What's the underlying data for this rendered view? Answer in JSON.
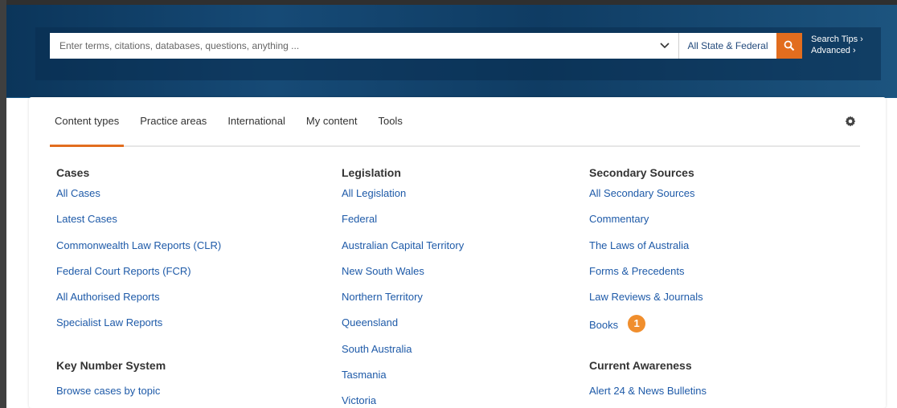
{
  "search": {
    "placeholder": "Enter terms, citations, databases, questions, anything ...",
    "jurisdiction": "All State & Federal",
    "tips_label": "Search Tips ›",
    "advanced_label": "Advanced ›"
  },
  "tabs": [
    {
      "label": "Content types",
      "active": true
    },
    {
      "label": "Practice areas"
    },
    {
      "label": "International"
    },
    {
      "label": "My content"
    },
    {
      "label": "Tools"
    }
  ],
  "columns": {
    "cases": {
      "heading": "Cases",
      "links": [
        "All Cases",
        "Latest Cases",
        "Commonwealth Law Reports (CLR)",
        "Federal Court Reports (FCR)",
        "All Authorised Reports",
        "Specialist Law Reports"
      ]
    },
    "key_number": {
      "heading": "Key Number System",
      "links": [
        "Browse cases by topic"
      ]
    },
    "legislation": {
      "heading": "Legislation",
      "links": [
        "All Legislation",
        "Federal",
        "Australian Capital Territory",
        "New South Wales",
        "Northern Territory",
        "Queensland",
        "South Australia",
        "Tasmania",
        "Victoria"
      ]
    },
    "secondary": {
      "heading": "Secondary Sources",
      "links": [
        "All Secondary Sources",
        "Commentary",
        "The Laws of Australia",
        "Forms & Precedents",
        "Law Reviews & Journals",
        "Books"
      ]
    },
    "current_awareness": {
      "heading": "Current Awareness",
      "links": [
        "Alert 24 & News Bulletins"
      ]
    }
  },
  "badge": "1",
  "colors": {
    "accent": "#e26d1e",
    "link": "#1e5aa8",
    "badge": "#f08e2d"
  }
}
